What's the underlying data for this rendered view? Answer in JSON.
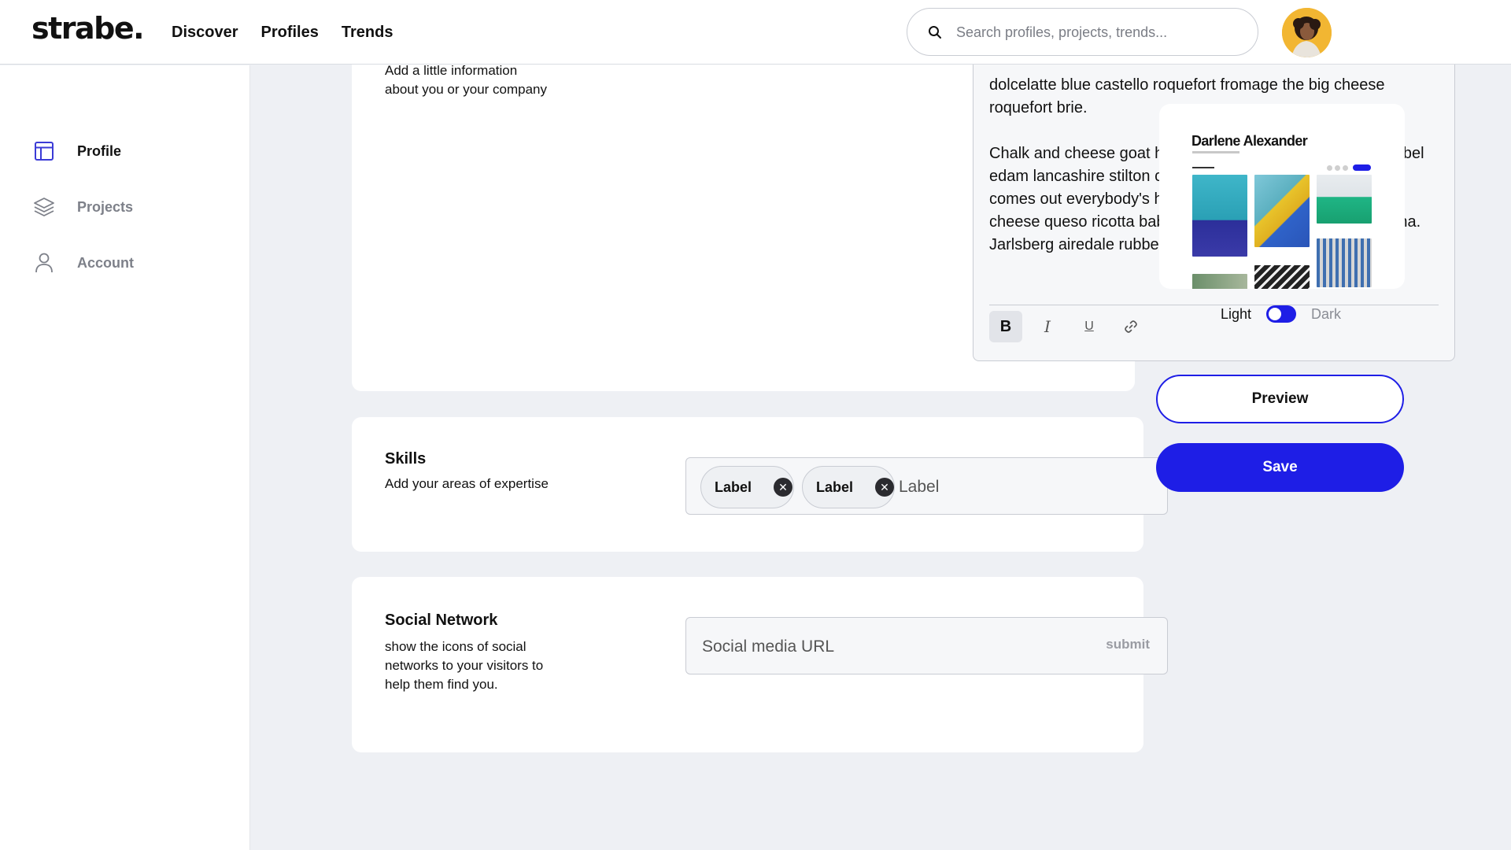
{
  "brand": {
    "logo": "strabe.",
    "accent": "#1e1ee6"
  },
  "nav": {
    "items": [
      "Discover",
      "Profiles",
      "Trends"
    ]
  },
  "search": {
    "placeholder": "Search profiles, projects, trends...",
    "icon": "search-icon"
  },
  "user": {
    "avatar": "avatar"
  },
  "sidebar": {
    "items": [
      {
        "label": "Profile",
        "icon": "layout-icon",
        "active": true
      },
      {
        "label": "Projects",
        "icon": "layers-icon",
        "active": false
      },
      {
        "label": "Account",
        "icon": "user-icon",
        "active": false
      }
    ]
  },
  "about": {
    "desc_visible": "Add a little information about you or your company",
    "paragraph1_tail": "dolcelatte blue castello roquefort fromage the big cheese roquefort brie.",
    "paragraph2": "Chalk and cheese goat hard cheese. Cheese on toast babybel edam lancashire stilton chalk and cheese when the cheese comes out everybody's happy blue castello. Edam rubber cheese queso ricotta babybel stilton parmesan danish fontina. Jarlsberg airedale rubber cheese the",
    "toolbar": {
      "bold": "B",
      "italic": "I",
      "underline": "U"
    }
  },
  "skills": {
    "title": "Skills",
    "desc": "Add your areas of expertise",
    "tags": [
      "Label",
      "Label"
    ],
    "input_placeholder": "Label"
  },
  "social": {
    "title": "Social Network",
    "desc": "show the icons of social networks to your visitors to help them find you.",
    "input_placeholder": "Social media URL",
    "submit_label": "submit"
  },
  "preview_card": {
    "name": "Darlene Alexander",
    "theme_light": "Light",
    "theme_dark": "Dark",
    "theme_dark_enabled": false
  },
  "actions": {
    "preview_label": "Preview",
    "save_label": "Save"
  }
}
